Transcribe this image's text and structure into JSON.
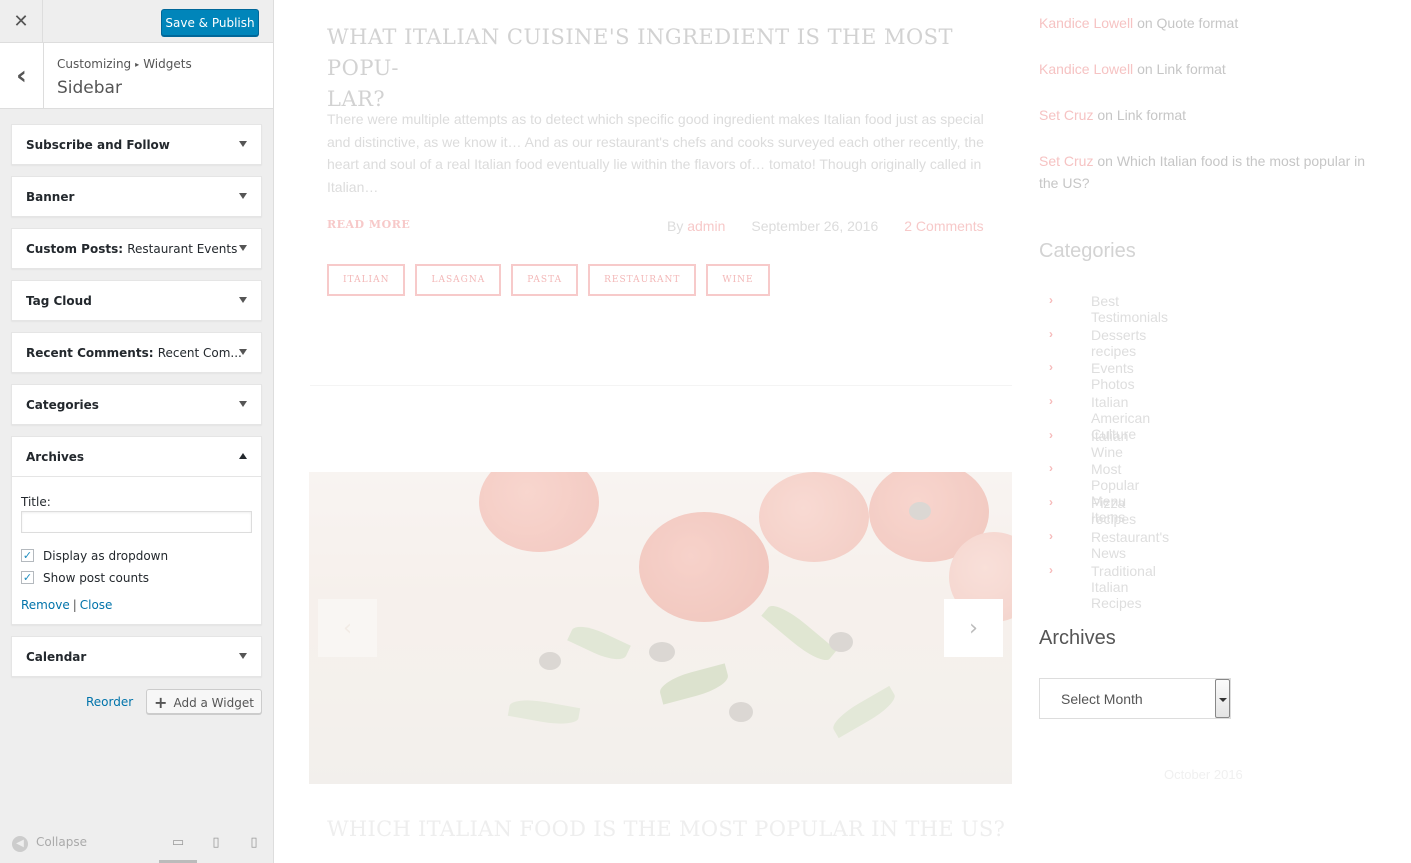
{
  "customizer": {
    "close_glyph": "✕",
    "save_label": "Save & Publish",
    "back_glyph": "‹",
    "breadcrumb": {
      "parent": "Customizing",
      "sep": "▸",
      "child": "Widgets"
    },
    "section_title": "Sidebar",
    "widgets": [
      {
        "title": "Subscribe and Follow",
        "subtitle": ""
      },
      {
        "title": "Banner",
        "subtitle": ""
      },
      {
        "title": "Custom Posts:",
        "subtitle": "Restaurant Events"
      },
      {
        "title": "Tag Cloud",
        "subtitle": ""
      },
      {
        "title": "Recent Comments:",
        "subtitle": "Recent Com..."
      },
      {
        "title": "Categories",
        "subtitle": ""
      },
      {
        "title": "Archives",
        "subtitle": ""
      },
      {
        "title": "Calendar",
        "subtitle": ""
      }
    ],
    "archives_form": {
      "title_label": "Title:",
      "title_value": "",
      "dropdown_label": "Display as dropdown",
      "dropdown_checked": true,
      "counts_label": "Show post counts",
      "counts_checked": true,
      "check_glyph": "✓",
      "remove_label": "Remove",
      "pipe": "|",
      "close_label": "Close"
    },
    "reorder_label": "Reorder",
    "add_widget_plus": "+",
    "add_widget_label": "Add a Widget",
    "collapse_glyph": "◀",
    "collapse_label": "Collapse",
    "device_icons": {
      "desktop": "▭",
      "tablet": "▯",
      "mobile": "▯"
    },
    "accent_color": "#0085ba",
    "link_color": "#0073aa"
  },
  "preview": {
    "post": {
      "title": "WHAT ITALIAN CUISINE'S INGREDIENT IS THE MOST POPU-LAR?",
      "title_line1": "WHAT ITALIAN CUISINE'S INGREDIENT IS THE MOST POPU-",
      "title_line2": "LAR?",
      "excerpt": "There were multiple attempts as to detect which specific good ingredient makes Italian food just as special and distinctive, as we know it… And as our restaurant's chefs and cooks surveyed each other recently, the heart and soul of a real Italian food eventually lie within the flavors of… tomato! Though originally called in Italian…",
      "read_more": "READ MORE",
      "by": "By",
      "author": "admin",
      "date": "September 26, 2016",
      "comments": "2 Comments",
      "tags": [
        "ITALIAN",
        "LASAGNA",
        "PASTA",
        "RESTAURANT",
        "WINE"
      ]
    },
    "slider": {
      "prev_glyph": "‹",
      "next_glyph": "›"
    },
    "next_post_title": "WHICH ITALIAN FOOD IS THE MOST POPULAR IN THE US?",
    "recent_comments": [
      {
        "author": "Kandice Lowell",
        "on": "on",
        "post": "Quote format"
      },
      {
        "author": "Kandice Lowell",
        "on": "on",
        "post": "Link format"
      },
      {
        "author": "Set Cruz",
        "on": "on",
        "post": "Link format"
      },
      {
        "author": "Set Cruz",
        "on": "on",
        "post": "Which Italian food is the most popular in the US?"
      }
    ],
    "categories_heading": "Categories",
    "categories": [
      "Best Testimonials",
      "Desserts recipes",
      "Events Photos",
      "Italian American Culture",
      "Italian Wine",
      "Most Popular Menu Items",
      "Pizza recipes",
      "Restaurant's News",
      "Traditional Italian Recipes"
    ],
    "chevron_glyph": "›",
    "archives_heading": "Archives",
    "archives_select": "Select Month",
    "calendar_caption": "October 2016",
    "accent_color": "#f6c3c3"
  }
}
